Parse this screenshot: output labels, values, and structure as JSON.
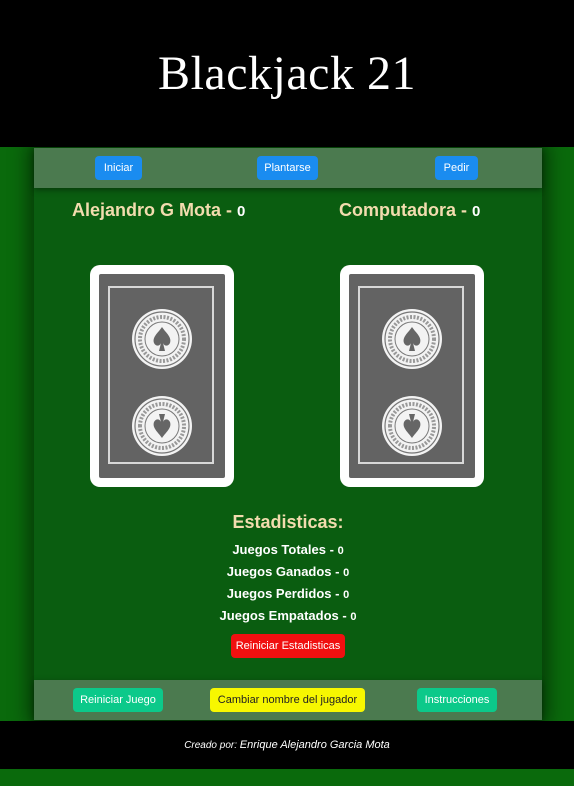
{
  "header": {
    "title": "Blackjack 21"
  },
  "top_bar": {
    "start_label": "Iniciar",
    "stand_label": "Plantarse",
    "hit_label": "Pedir"
  },
  "player": {
    "name": "Alejandro G Mota",
    "separator": " - ",
    "score": "0"
  },
  "computer": {
    "name": "Computadora",
    "separator": " - ",
    "score": "0"
  },
  "cards": {
    "back_seal_text": "AMERICAN CONTRACT BRIDGE LEAGUE",
    "colors": {
      "back": "#636363",
      "border": "#ffffff"
    }
  },
  "stats": {
    "title": "Estadisticas:",
    "rows": [
      {
        "label": "Juegos Totales",
        "value": "0"
      },
      {
        "label": "Juegos Ganados",
        "value": "0"
      },
      {
        "label": "Juegos Perdidos",
        "value": "0"
      },
      {
        "label": "Juegos Empatados",
        "value": "0"
      }
    ],
    "separator": " - ",
    "reset_label": "Reiniciar Estadisticas"
  },
  "bottom_bar": {
    "restart_label": "Reiniciar Juego",
    "rename_label": "Cambiar nombre del jugador",
    "instructions_label": "Instrucciones"
  },
  "footer": {
    "prefix": "Creado por:",
    "author": "Enrique Alejandro Garcia Mota"
  },
  "colors": {
    "table_green": "#0a5d10",
    "bar_green": "#4b7a4f",
    "primary_blue": "#1a8cf0",
    "danger_red": "#f01010",
    "success_green": "#0cc98a",
    "warning_yellow": "#f7f700",
    "name_color": "#f2dcae"
  }
}
